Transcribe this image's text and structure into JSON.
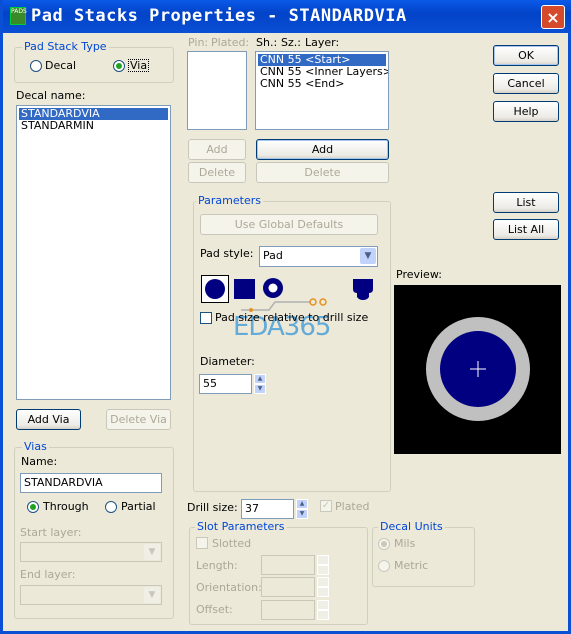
{
  "window": {
    "title": "Pad Stacks Properties - STANDARDVIA",
    "app_icon_text": "PADS",
    "close_glyph": "×"
  },
  "pad_stack_type": {
    "legend": "Pad Stack Type",
    "decal_label": "Decal",
    "via_label": "Via",
    "selected": "via"
  },
  "decal_list": {
    "label": "Decal name:",
    "items": [
      "STANDARDVIA",
      "STANDARMIN"
    ],
    "selected": "STANDARDVIA"
  },
  "left_buttons": {
    "add_via": "Add Via",
    "delete_via": "Delete Via"
  },
  "vias": {
    "legend": "Vias",
    "name_label": "Name:",
    "name_value": "STANDARDVIA",
    "through_label": "Through",
    "partial_label": "Partial",
    "selected": "through",
    "start_layer_label": "Start layer:",
    "end_layer_label": "End layer:",
    "combo_arrow": "▼"
  },
  "pin_list": {
    "header_pin": "Pin:",
    "header_plated": "Plated:",
    "add_label": "Add",
    "delete_label": "Delete"
  },
  "layer_list": {
    "header_sh": "Sh.:",
    "header_sz": "Sz.:",
    "header_layer": "Layer:",
    "items": [
      "CNN 55 <Start>",
      "CNN 55 <Inner Layers>",
      "CNN 55 <End>"
    ],
    "selected": "CNN 55 <Start>",
    "add_label": "Add",
    "delete_label": "Delete"
  },
  "right_buttons": {
    "ok": "OK",
    "cancel": "Cancel",
    "help": "Help",
    "list": "List",
    "list_all": "List All"
  },
  "parameters": {
    "legend": "Parameters",
    "use_global_defaults": "Use Global Defaults",
    "pad_style_label": "Pad style:",
    "pad_style_value": "Pad",
    "combo_arrow": "▼",
    "shapes": [
      "round-pad-icon",
      "square-pad-icon",
      "annular-pad-icon",
      "odd-shape-pad-icon"
    ],
    "selected_shape": "round-pad-icon",
    "relative_checkbox_label": "Pad size relative to drill size",
    "diameter_label": "Diameter:",
    "diameter_value": "55",
    "spin_up": "▲",
    "spin_down": "▼"
  },
  "watermark": "EDA365",
  "preview": {
    "label": "Preview:",
    "background_color": "#000000",
    "ring_color": "#c0c0c0",
    "pad_color": "#000080",
    "crosshair_color": "#ffffff"
  },
  "drill": {
    "label": "Drill size:",
    "value": "37",
    "plated_label": "Plated",
    "check_glyph": "✓"
  },
  "slot_parameters": {
    "legend": "Slot Parameters",
    "slotted_label": "Slotted",
    "length_label": "Length:",
    "orientation_label": "Orientation:",
    "offset_label": "Offset:"
  },
  "decal_units": {
    "legend": "Decal Units",
    "mils_label": "Mils",
    "metric_label": "Metric",
    "selected": "mils"
  }
}
